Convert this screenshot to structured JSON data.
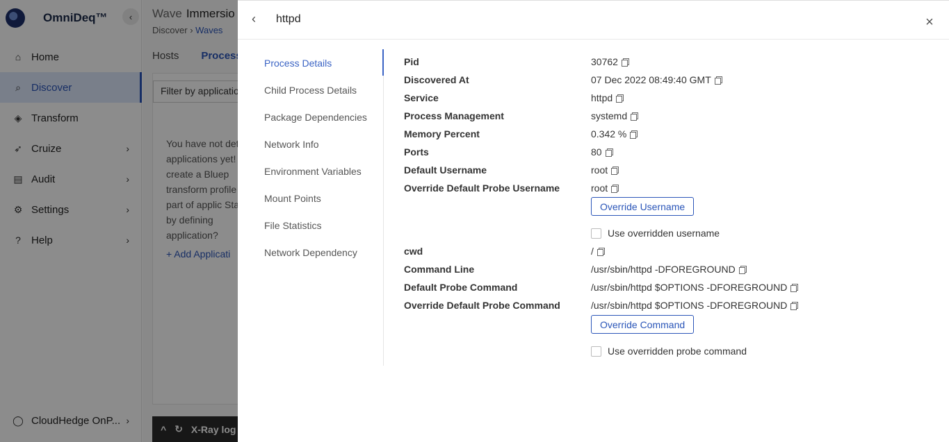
{
  "app": {
    "brand": "OmniDeq™",
    "collapse_icon": "‹",
    "nav": [
      {
        "label": "Home",
        "icon": "home-icon",
        "glyph": "⌂"
      },
      {
        "label": "Discover",
        "icon": "discover-icon",
        "glyph": "⌕"
      },
      {
        "label": "Transform",
        "icon": "cube-icon",
        "glyph": "◈"
      },
      {
        "label": "Cruize",
        "icon": "rocket-icon",
        "glyph": "➶",
        "chevron": "›"
      },
      {
        "label": "Audit",
        "icon": "clipboard-icon",
        "glyph": "▤",
        "chevron": "›"
      },
      {
        "label": "Settings",
        "icon": "gear-icon",
        "glyph": "⚙",
        "chevron": "›"
      },
      {
        "label": "Help",
        "icon": "help-icon",
        "glyph": "?",
        "chevron": "›"
      }
    ],
    "account": {
      "label": "CloudHedge OnP...",
      "glyph": "◯",
      "chevron": "›"
    },
    "page_title_prefix": "Wave",
    "page_title": "Immersio",
    "breadcrumb": {
      "root": "Discover",
      "sep": "›",
      "current": "Waves"
    },
    "tabs": [
      "Hosts",
      "Processe"
    ],
    "filter_placeholder": "Filter by applicatio",
    "empty_message": "You have not det applications yet! to create a Bluep transform profile be part of applic Start by defining application?",
    "add_application": "+ Add Applicati",
    "xray": {
      "chevron": "^",
      "glyph": "↻",
      "label": "X-Ray log"
    }
  },
  "drawer": {
    "back_icon": "‹",
    "title": "httpd",
    "close_icon": "×",
    "subnav": [
      "Process Details",
      "Child Process Details",
      "Package Dependencies",
      "Network Info",
      "Environment Variables",
      "Mount Points",
      "File Statistics",
      "Network Dependency"
    ],
    "active_subnav": "Process Details",
    "details": {
      "pid": {
        "label": "Pid",
        "value": "30762"
      },
      "discovered_at": {
        "label": "Discovered At",
        "value": "07 Dec 2022 08:49:40 GMT"
      },
      "service": {
        "label": "Service",
        "value": "httpd"
      },
      "process_management": {
        "label": "Process Management",
        "value": "systemd"
      },
      "memory_percent": {
        "label": "Memory Percent",
        "value": "0.342 %"
      },
      "ports": {
        "label": "Ports",
        "value": "80"
      },
      "default_username": {
        "label": "Default Username",
        "value": "root"
      },
      "override_default_probe_username": {
        "label": "Override Default Probe Username",
        "value": "root"
      },
      "override_username_button": "Override Username",
      "use_overridden_username": "Use overridden username",
      "cwd": {
        "label": "cwd",
        "value": "/"
      },
      "command_line": {
        "label": "Command Line",
        "value": "/usr/sbin/httpd -DFOREGROUND"
      },
      "default_probe_command": {
        "label": "Default Probe Command",
        "value": "/usr/sbin/httpd $OPTIONS -DFOREGROUND"
      },
      "override_default_probe_command": {
        "label": "Override Default Probe Command",
        "value": "/usr/sbin/httpd $OPTIONS -DFOREGROUND"
      },
      "override_command_button": "Override Command",
      "use_overridden_probe_command": "Use overridden probe command"
    }
  },
  "colors": {
    "accent": "#2a55b8",
    "overlay": "rgba(0,0,0,0.45)"
  }
}
